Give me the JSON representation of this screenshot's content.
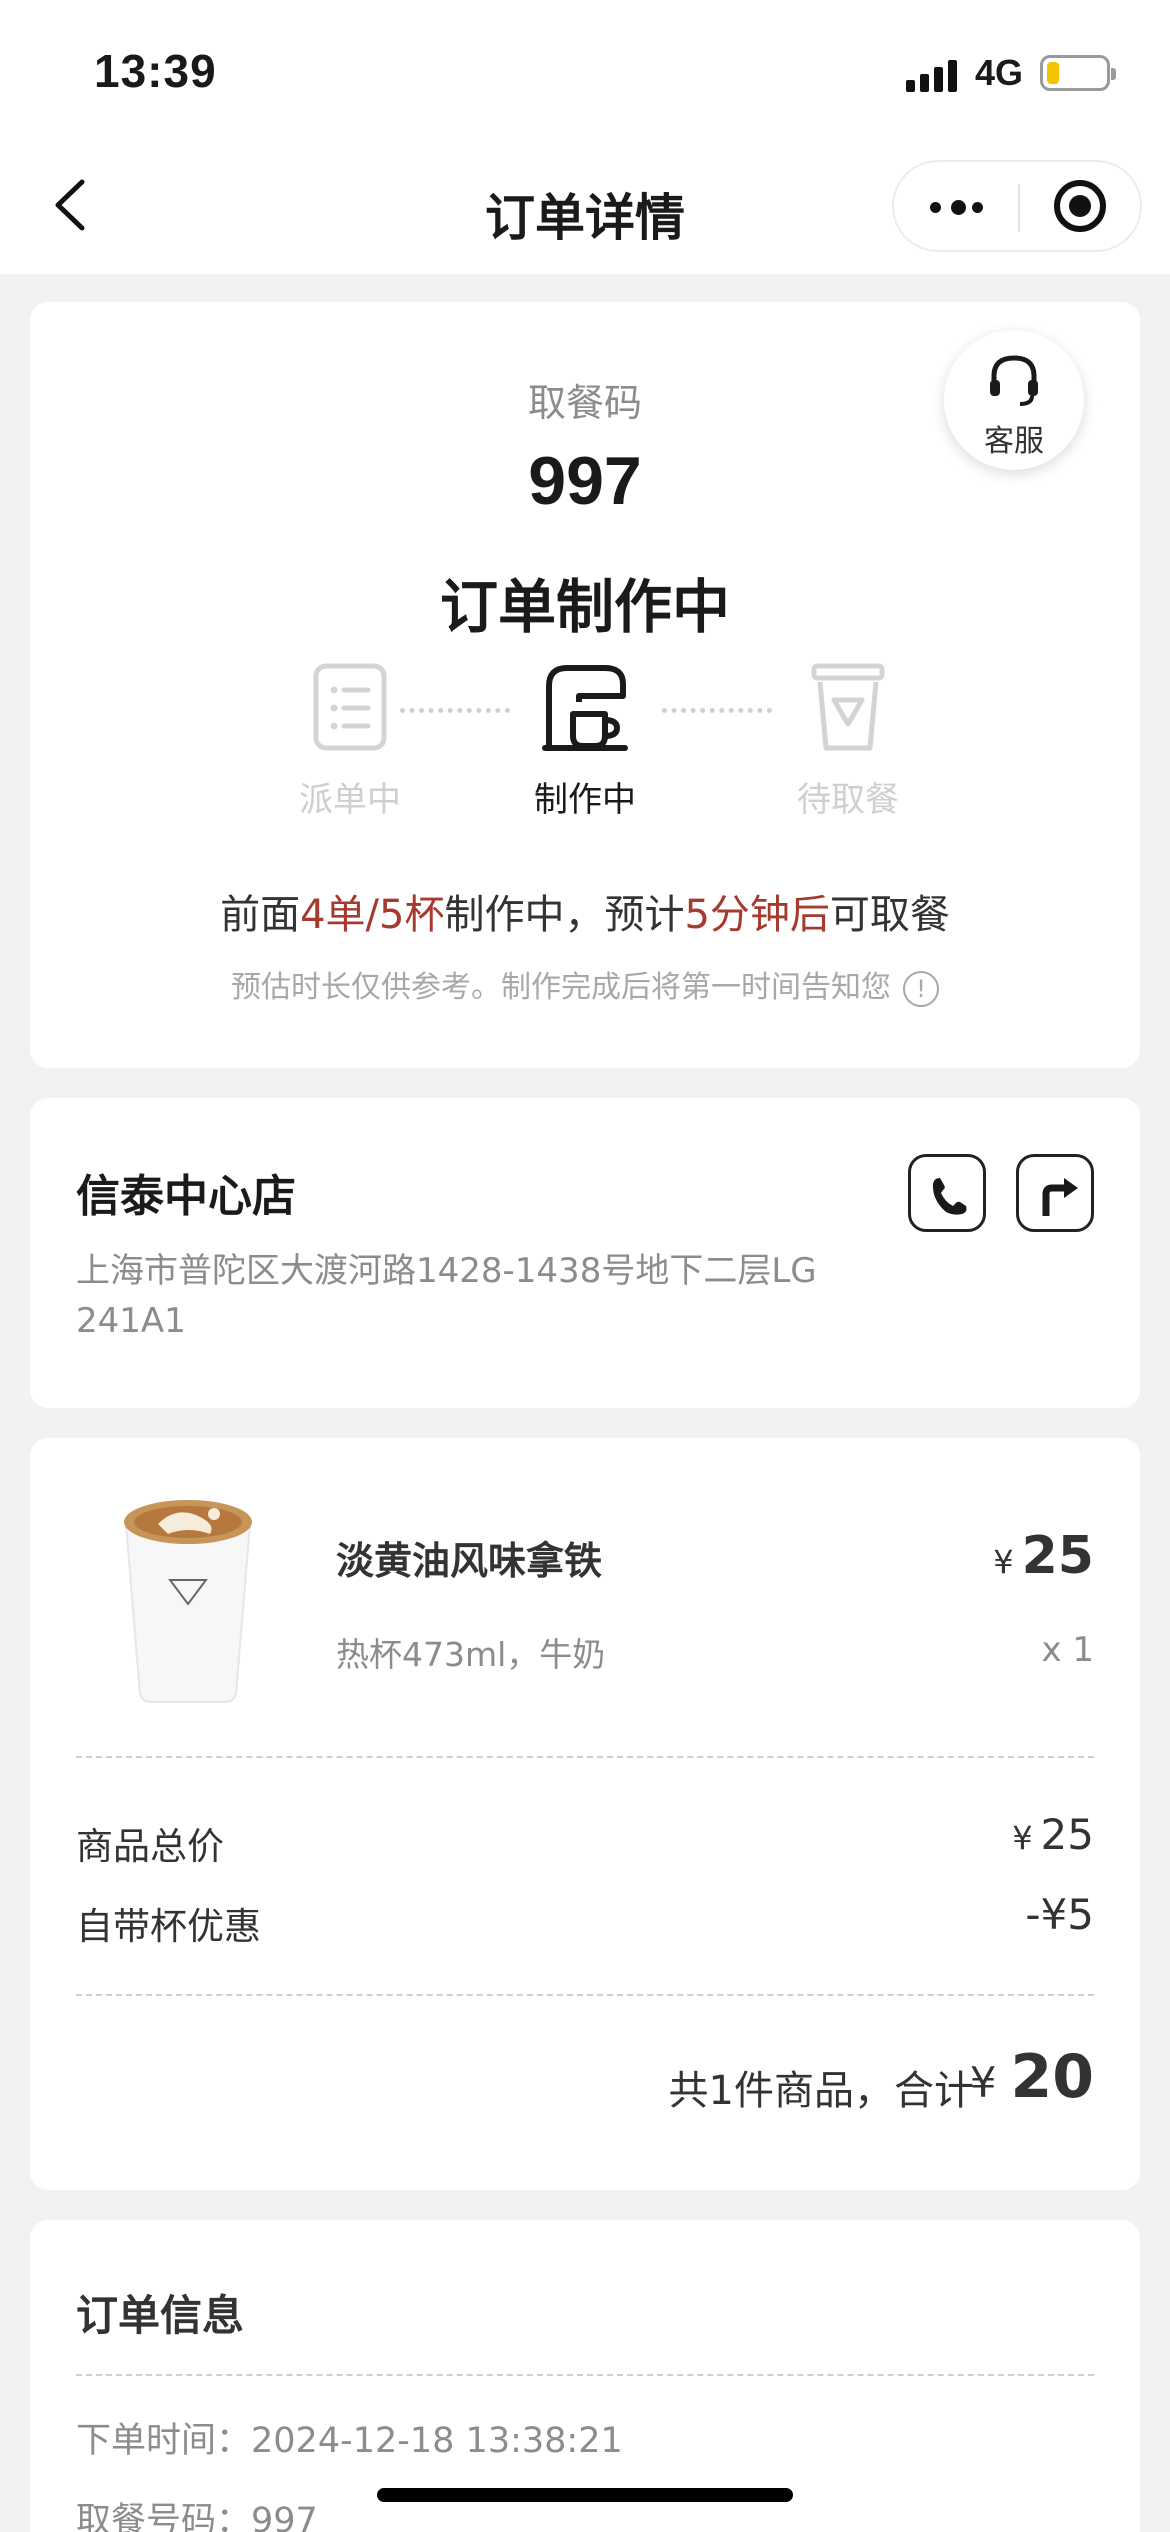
{
  "status_bar": {
    "time": "13:39",
    "network": "4G"
  },
  "nav": {
    "title": "订单详情"
  },
  "status_card": {
    "service_label": "客服",
    "pickup_label": "取餐码",
    "pickup_code": "997",
    "order_status": "订单制作中",
    "steps": [
      {
        "label": "派单中",
        "icon": "clipboard-icon",
        "active": false
      },
      {
        "label": "制作中",
        "icon": "coffee-machine-icon",
        "active": true
      },
      {
        "label": "待取餐",
        "icon": "cup-icon",
        "active": false
      }
    ],
    "progress": {
      "prefix": "前面",
      "queue": "4单/5杯",
      "middle": "制作中，预计",
      "eta": "5分钟后",
      "suffix": "可取餐"
    },
    "note": "预估时长仅供参考。制作完成后将第一时间告知您"
  },
  "store": {
    "name": "信泰中心店",
    "address": "上海市普陀区大渡河路1428-1438号地下二层LG 241A1"
  },
  "goods": {
    "name": "淡黄油风味拿铁",
    "spec": "热杯473ml，牛奶",
    "currency": "¥",
    "price": "25",
    "qty": "x 1",
    "subtotal_label": "商品总价",
    "subtotal": "25",
    "discount_label": "自带杯优惠",
    "discount": "-¥5",
    "total_label": "共1件商品，合计",
    "total": "20"
  },
  "order_info": {
    "title": "订单信息",
    "time_label": "下单时间：",
    "time": "2024-12-18 13:38:21",
    "code_label": "取餐号码：",
    "code": "997"
  },
  "colors": {
    "accent": "#a53a2f",
    "battery": "#f5c400"
  }
}
